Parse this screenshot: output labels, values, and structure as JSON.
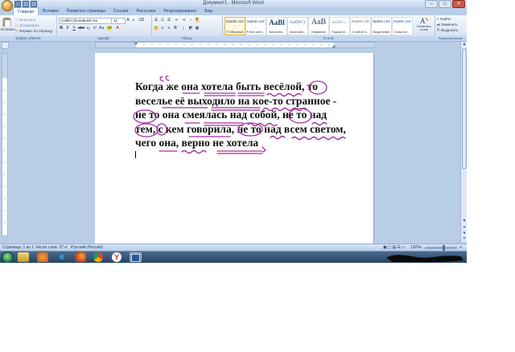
{
  "window": {
    "title": "Документ1 - Microsoft Word"
  },
  "tabs": [
    {
      "label": "Главная",
      "active": true
    },
    {
      "label": "Вставка"
    },
    {
      "label": "Разметка страницы"
    },
    {
      "label": "Ссылки"
    },
    {
      "label": "Рассылки"
    },
    {
      "label": "Рецензирование"
    },
    {
      "label": "Вид"
    }
  ],
  "ribbon": {
    "clipboard": {
      "paste_label": "Вставить",
      "cut_label": "Вырезать",
      "copy_label": "Копировать",
      "format_painter_label": "Формат по образцу",
      "group_label": "Буфер обмена"
    },
    "font": {
      "font_name": "Calibri (Основной тек",
      "font_size": "11",
      "group_label": "Шрифт"
    },
    "paragraph": {
      "group_label": "Абзац"
    },
    "styles": {
      "items": [
        {
          "sample": "AaBbCcDc",
          "name": "¶ Обычный",
          "selected": true
        },
        {
          "sample": "AaBbCcDc",
          "name": "¶ Без инте..."
        },
        {
          "sample": "AaBl",
          "name": "Заголово..."
        },
        {
          "sample": "AaBbCc",
          "name": "Заголово..."
        },
        {
          "sample": "AaB",
          "name": "Название"
        },
        {
          "sample": "AaBbCc.",
          "name": "Подзагол..."
        },
        {
          "sample": "AaBbCcDc",
          "name": "Слабое в..."
        },
        {
          "sample": "AaBbCcDc",
          "name": "Выделение"
        },
        {
          "sample": "AaBbCcDc",
          "name": "Сильное ..."
        }
      ],
      "change_styles_label": "Изменить стили",
      "group_label": "Стили"
    },
    "editing": {
      "find_label": "Найти",
      "replace_label": "Заменить",
      "select_label": "Выделить",
      "group_label": "Редактирование"
    }
  },
  "document": {
    "lines": [
      "Когда же она хотела быть весёлой, то",
      "веселье её выходило на кое-то странное -",
      "не то она смеялась над собой, не то над",
      "тем, с кем говорила, не то над всем светом,",
      "чего она, верно не хотела"
    ]
  },
  "status": {
    "page": "Страница: 1 из 1",
    "words": "Число слов: 37",
    "language": "Русский (Россия)",
    "zoom": "130%",
    "zoom_value": 130
  },
  "colors": {
    "annotation_pen": "#a3309e",
    "ribbon_bg": "#dbe6f4",
    "workspace_bg": "#b9cde6"
  }
}
